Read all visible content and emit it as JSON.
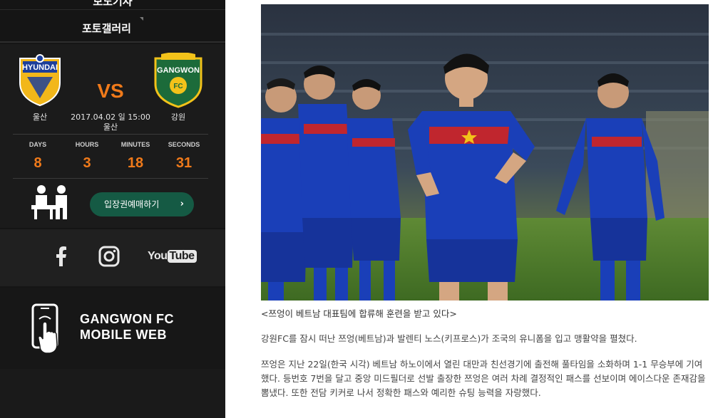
{
  "sidebar": {
    "menu_press": "보도기사",
    "menu_gallery": "포토갤러리",
    "match": {
      "home_team": "울산",
      "away_team": "강원",
      "home_logo_text": "HYUNDAI",
      "away_logo_text": "GANGWON",
      "vs": "VS",
      "datetime": "2017.04.02 일 15:00",
      "venue": "울산"
    },
    "countdown": {
      "days_label": "DAYS",
      "days": "8",
      "hours_label": "HOURS",
      "hours": "3",
      "minutes_label": "MINUTES",
      "minutes": "18",
      "seconds_label": "SECONDS",
      "seconds": "31"
    },
    "ticket_button": "입장권예매하기",
    "ticket_chevron": "›",
    "social": {
      "youtube_you": "You",
      "youtube_tube": "Tube"
    },
    "mobile_web": {
      "line1": "GANGWON FC",
      "line2": "MOBILE WEB"
    }
  },
  "article": {
    "caption": "<쯔엉이 베트남 대표팀에 합류해 훈련을 받고 있다>",
    "paragraphs": [
      "강원FC를 잠시 떠난 쯔엉(베트남)과 발렌티 노스(키프로스)가 조국의 유니폼을 입고 맹활약을 펼쳤다.",
      "쯔엉은 지난 22일(한국 시각) 베트남 하노이에서 열린 대만과 친선경기에 출전해 풀타임을 소화하며 1-1 무승부에 기여했다. 등번호 7번을 달고 중앙 미드필더로 선발 출장한 쯔엉은 여러 차례 결정적인 패스를 선보이며 에이스다운 존재감을 뽐냈다. 또한 전담 키커로 나서 정확한 패스와 예리한 슈팅 능력을 자랑했다."
    ]
  },
  "colors": {
    "sidebar_bg": "#151515",
    "accent_orange": "#f07a1a",
    "ticket_green": "#155a44",
    "jersey_blue": "#1a3fb8",
    "pitch_green": "#4a7a2a"
  }
}
